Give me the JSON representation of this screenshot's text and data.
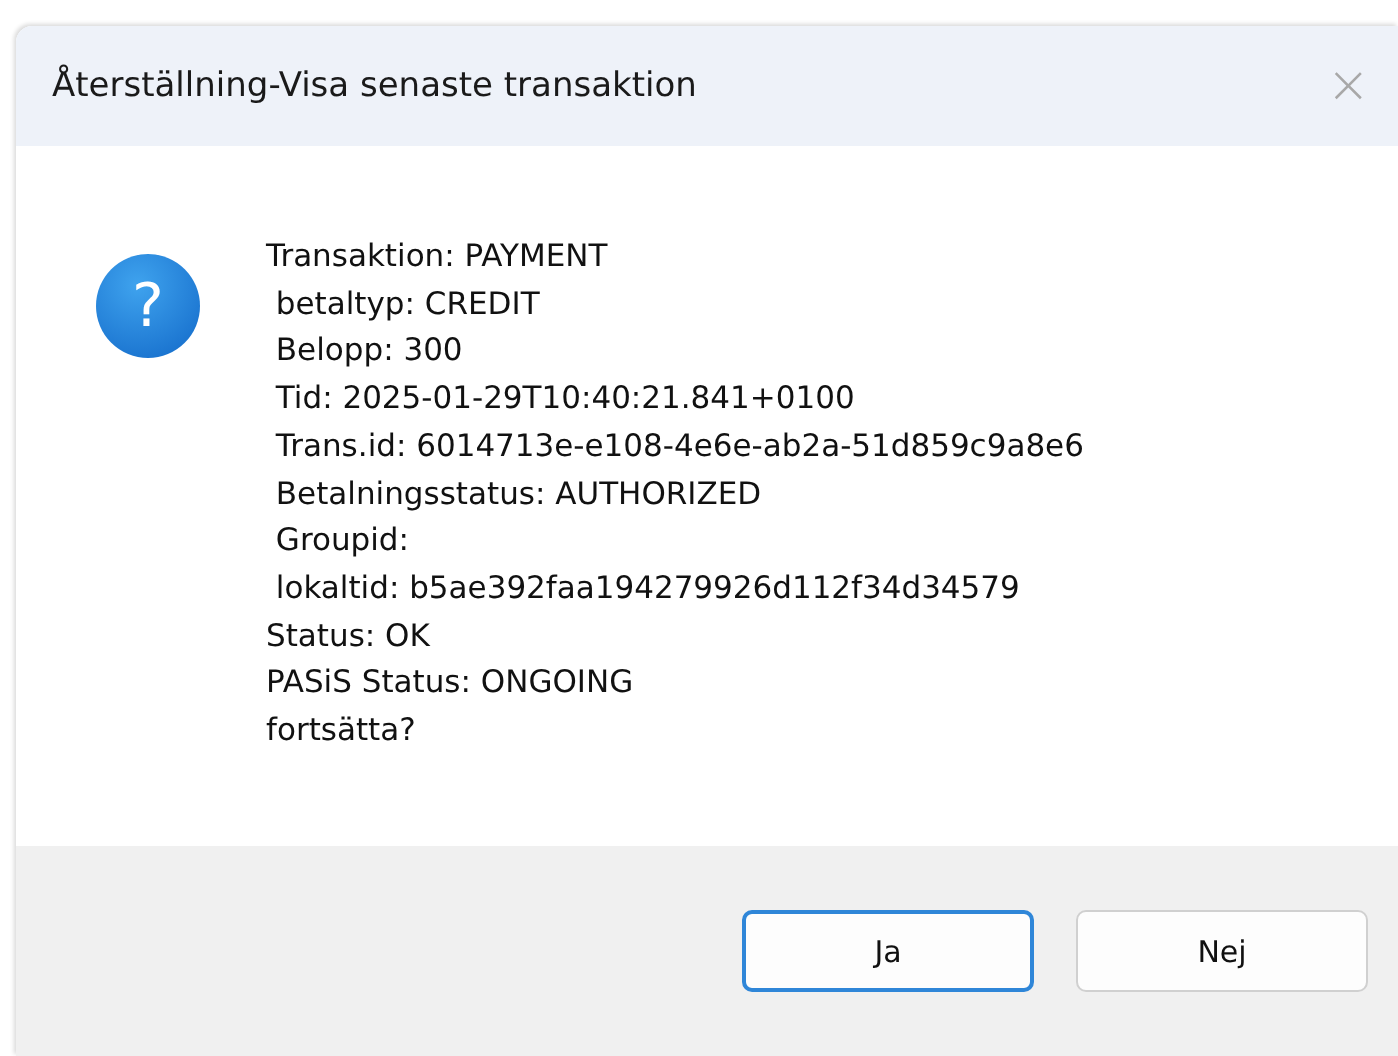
{
  "window": {
    "title": "Återställning-Visa senaste transaktion",
    "close": "×"
  },
  "message": {
    "icon": "?",
    "lines": [
      "Transaktion: PAYMENT",
      " betaltyp: CREDIT",
      " Belopp: 300",
      " Tid: 2025-01-29T10:40:21.841+0100",
      " Trans.id: 6014713e-e108-4e6e-ab2a-51d859c9a8e6",
      " Betalningsstatus: AUTHORIZED",
      " Groupid:",
      " lokaltid: b5ae392faa194279926d112f34d34579",
      "Status: OK",
      "PASiS Status: ONGOING",
      "fortsätta?"
    ]
  },
  "buttons": [
    {
      "label": "Ja",
      "default": true
    },
    {
      "label": "Nej",
      "default": false
    }
  ]
}
